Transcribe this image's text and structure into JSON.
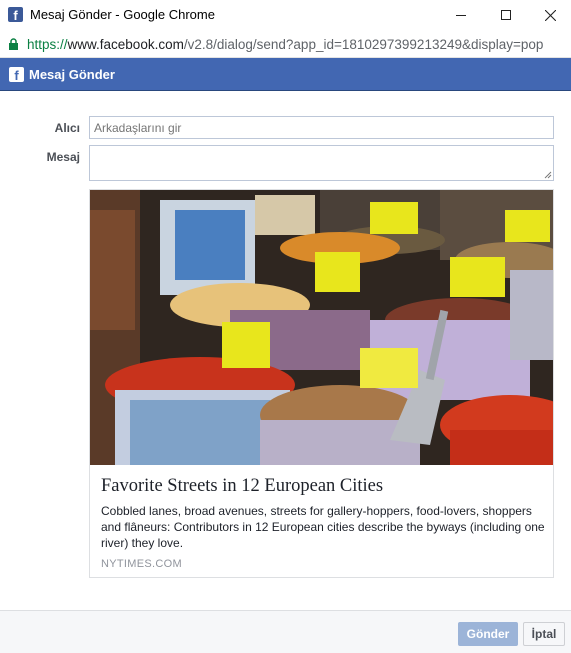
{
  "window": {
    "title": "Mesaj Gönder - Google Chrome",
    "favicon_letter": "f"
  },
  "urlbar": {
    "scheme": "https://",
    "host": "www.facebook.com",
    "path": "/v2.8/dialog/send?app_id=1810297399213249&display=pop"
  },
  "dialog": {
    "header_title": "Mesaj Gönder",
    "header_icon_letter": "f"
  },
  "form": {
    "to_label": "Alıcı",
    "to_placeholder": "Arkadaşlarını gir",
    "message_label": "Mesaj",
    "message_value": ""
  },
  "card": {
    "title": "Favorite Streets in 12 European Cities",
    "description": "Cobbled lanes, broad avenues, streets for gallery-hoppers, food-lovers, shoppers and flâneurs: Contributors in 12 European cities describe the byways (including one river) they love.",
    "source": "NYTIMES.COM"
  },
  "buttons": {
    "send": "Gönder",
    "cancel": "İptal"
  },
  "colors": {
    "fb_blue": "#4267b2",
    "send_disabled": "#9cb4d8",
    "secure_green": "#0b8043"
  },
  "icons": {
    "favicon": "facebook-icon",
    "lock": "lock-icon",
    "minimize": "minimize-icon",
    "maximize": "maximize-icon",
    "close": "close-icon"
  }
}
